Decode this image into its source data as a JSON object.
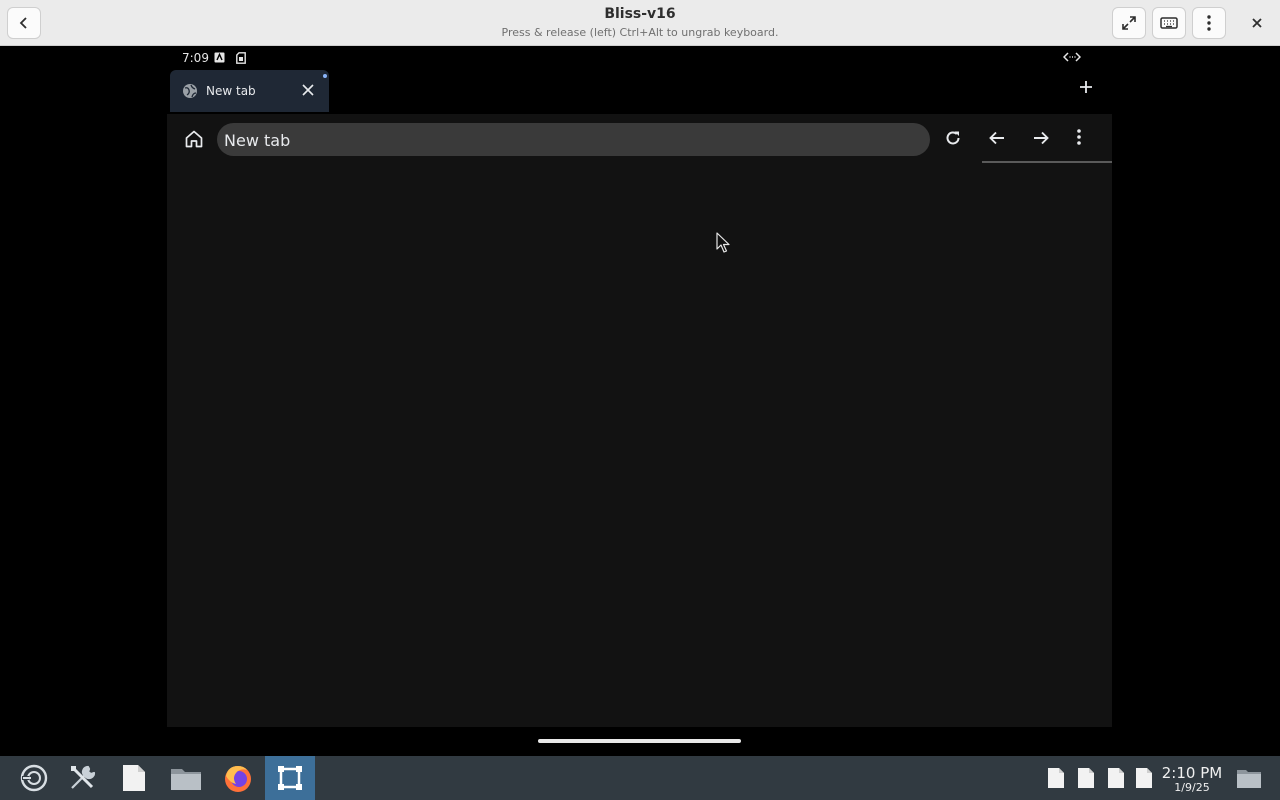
{
  "window": {
    "title": "Bliss-v16",
    "subtitle": "Press & release (left) Ctrl+Alt to ungrab keyboard."
  },
  "android": {
    "status_time": "7:09",
    "tab": {
      "label": "New tab"
    },
    "omnibox": {
      "value": "New tab"
    }
  },
  "taskbar": {
    "time": "2:10 PM",
    "date": "1/9/25"
  },
  "colors": {
    "titlebar_bg": "#ebebeb",
    "taskbar_bg": "#313a41",
    "taskbar_active": "#3d6f99",
    "browser_bg": "#121212",
    "tab_bg": "#1f2835",
    "omnibox_bg": "#3a3a3a"
  }
}
